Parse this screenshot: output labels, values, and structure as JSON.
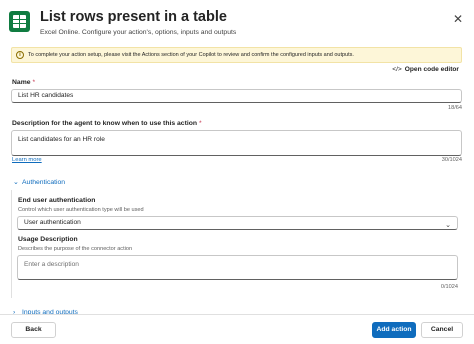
{
  "header": {
    "title": "List rows present in a table",
    "subtitle": "Excel Online. Configure your action's, options, inputs and outputs",
    "close_icon": "close-icon",
    "app_icon": "excel-table-icon",
    "app_icon_color": "#107c41"
  },
  "banner": {
    "icon": "info-icon",
    "text": "To complete your action setup, please visit the Actions section of your Copilot to review and confirm the configured inputs and outputs.",
    "background": "#fdf6d8"
  },
  "code_editor": {
    "icon": "code-icon",
    "glyph": "</>",
    "label": "Open code editor"
  },
  "name_field": {
    "label": "Name",
    "required_mark": "*",
    "value": "List HR candidates",
    "count": "18/64"
  },
  "description_field": {
    "label": "Description for the agent to know when to use this action",
    "required_mark": "*",
    "value": "List candidates for an HR role",
    "count": "30/1024",
    "learn_more": "Learn more"
  },
  "authentication": {
    "section_label": "Authentication",
    "chevron_icon": "chevron-down-icon",
    "end_user_auth": {
      "label": "End user authentication",
      "help": "Control which user authentication type will be used",
      "selected": "User authentication",
      "arrow_icon": "chevron-down-icon"
    },
    "usage_description": {
      "label": "Usage Description",
      "help": "Describes the purpose of the connector action",
      "placeholder": "Enter a description",
      "count": "0/1024"
    }
  },
  "inputs_outputs": {
    "section_label": "Inputs and outputs"
  },
  "footer": {
    "back_label": "Back",
    "add_label": "Add action",
    "cancel_label": "Cancel",
    "primary_color": "#0f6cbd"
  }
}
